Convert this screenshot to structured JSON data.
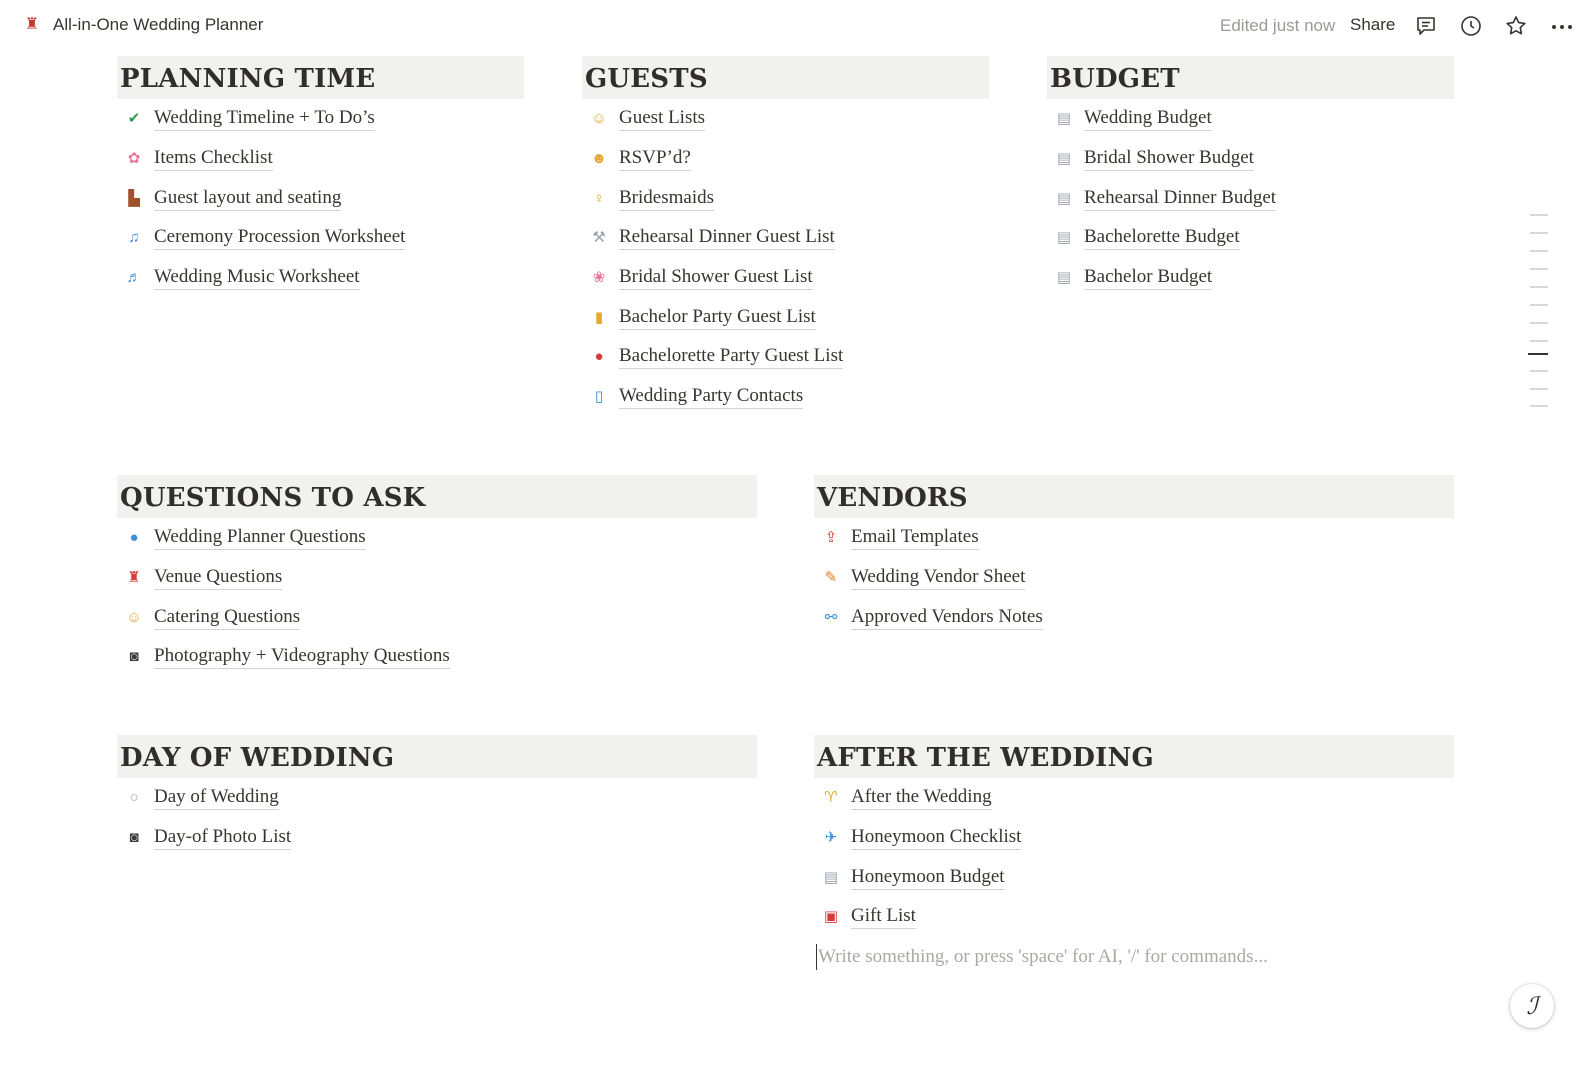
{
  "header": {
    "title": "All-in-One Wedding Planner",
    "edited": "Edited just now",
    "share": "Share"
  },
  "sections": {
    "planning": {
      "title": "PLANNING TIME",
      "items": [
        {
          "icon": "check-icon",
          "glyph": "✅",
          "label": "Wedding Timeline + To Do’s"
        },
        {
          "icon": "flower-icon",
          "glyph": "✿",
          "label": "Items Checklist"
        },
        {
          "icon": "chair-icon",
          "glyph": "▙",
          "label": "Guest layout and seating"
        },
        {
          "icon": "music-note-icon",
          "glyph": "♫",
          "label": "Ceremony Procession Worksheet"
        },
        {
          "icon": "music-notes-icon",
          "glyph": "♬",
          "label": "Wedding Music Worksheet"
        }
      ]
    },
    "guests": {
      "title": "GUESTS",
      "items": [
        {
          "icon": "people-icon",
          "glyph": "☺",
          "label": "Guest Lists"
        },
        {
          "icon": "person-shrug-icon",
          "glyph": "☻",
          "label": "RSVP’d?"
        },
        {
          "icon": "women-holding-hands-icon",
          "glyph": "♀",
          "label": "Bridesmaids"
        },
        {
          "icon": "fork-knife-icon",
          "glyph": "⚒",
          "label": "Rehearsal Dinner Guest List"
        },
        {
          "icon": "bouquet-icon",
          "glyph": "❀",
          "label": "Bridal Shower Guest List"
        },
        {
          "icon": "beer-icon",
          "glyph": "▮",
          "label": "Bachelor Party Guest List"
        },
        {
          "icon": "balloon-icon",
          "glyph": "●",
          "label": "Bachelorette Party Guest List"
        },
        {
          "icon": "phone-arrow-icon",
          "glyph": "▯",
          "label": "Wedding Party Contacts"
        }
      ]
    },
    "budget": {
      "title": "BUDGET",
      "items": [
        {
          "icon": "document-icon",
          "glyph": "▤",
          "label": "Wedding Budget"
        },
        {
          "icon": "document-icon",
          "glyph": "▤",
          "label": "Bridal Shower Budget"
        },
        {
          "icon": "document-icon",
          "glyph": "▤",
          "label": "Rehearsal Dinner Budget"
        },
        {
          "icon": "document-icon",
          "glyph": "▤",
          "label": "Bachelorette Budget"
        },
        {
          "icon": "document-icon",
          "glyph": "▤",
          "label": "Bachelor Budget"
        }
      ]
    },
    "questions": {
      "title": "QUESTIONS TO ASK",
      "items": [
        {
          "icon": "person-silhouette-icon",
          "glyph": "●",
          "label": "Wedding Planner Questions"
        },
        {
          "icon": "wedding-chapel-icon",
          "glyph": "♜",
          "label": "Venue Questions"
        },
        {
          "icon": "yum-face-icon",
          "glyph": "☺",
          "label": "Catering Questions"
        },
        {
          "icon": "camera-flash-icon",
          "glyph": "◙",
          "label": "Photography + Videography Questions"
        }
      ]
    },
    "vendors": {
      "title": "VENDORS",
      "items": [
        {
          "icon": "outbox-icon",
          "glyph": "⇪",
          "label": "Email Templates"
        },
        {
          "icon": "pencil-icon",
          "glyph": "✎",
          "label": "Wedding Vendor Sheet"
        },
        {
          "icon": "link-icon",
          "glyph": "⚯",
          "label": "Approved Vendors Notes"
        }
      ]
    },
    "dayof": {
      "title": "DAY OF WEDDING",
      "items": [
        {
          "icon": "ring-icon",
          "glyph": "○",
          "label": "Day of Wedding"
        },
        {
          "icon": "camera-icon",
          "glyph": "◙",
          "label": "Day-of Photo List"
        }
      ]
    },
    "after": {
      "title": "AFTER THE WEDDING",
      "items": [
        {
          "icon": "clinking-glasses-icon",
          "glyph": "♈",
          "label": "After the Wedding"
        },
        {
          "icon": "airplane-icon",
          "glyph": "✈",
          "label": "Honeymoon Checklist"
        },
        {
          "icon": "document-icon",
          "glyph": "▤",
          "label": "Honeymoon Budget"
        },
        {
          "icon": "gift-icon",
          "glyph": "▣",
          "label": "Gift List"
        }
      ]
    }
  },
  "editor": {
    "placeholder": "Write something, or press 'space' for AI, '/' for commands..."
  },
  "help": {
    "glyph": "ℐ"
  }
}
